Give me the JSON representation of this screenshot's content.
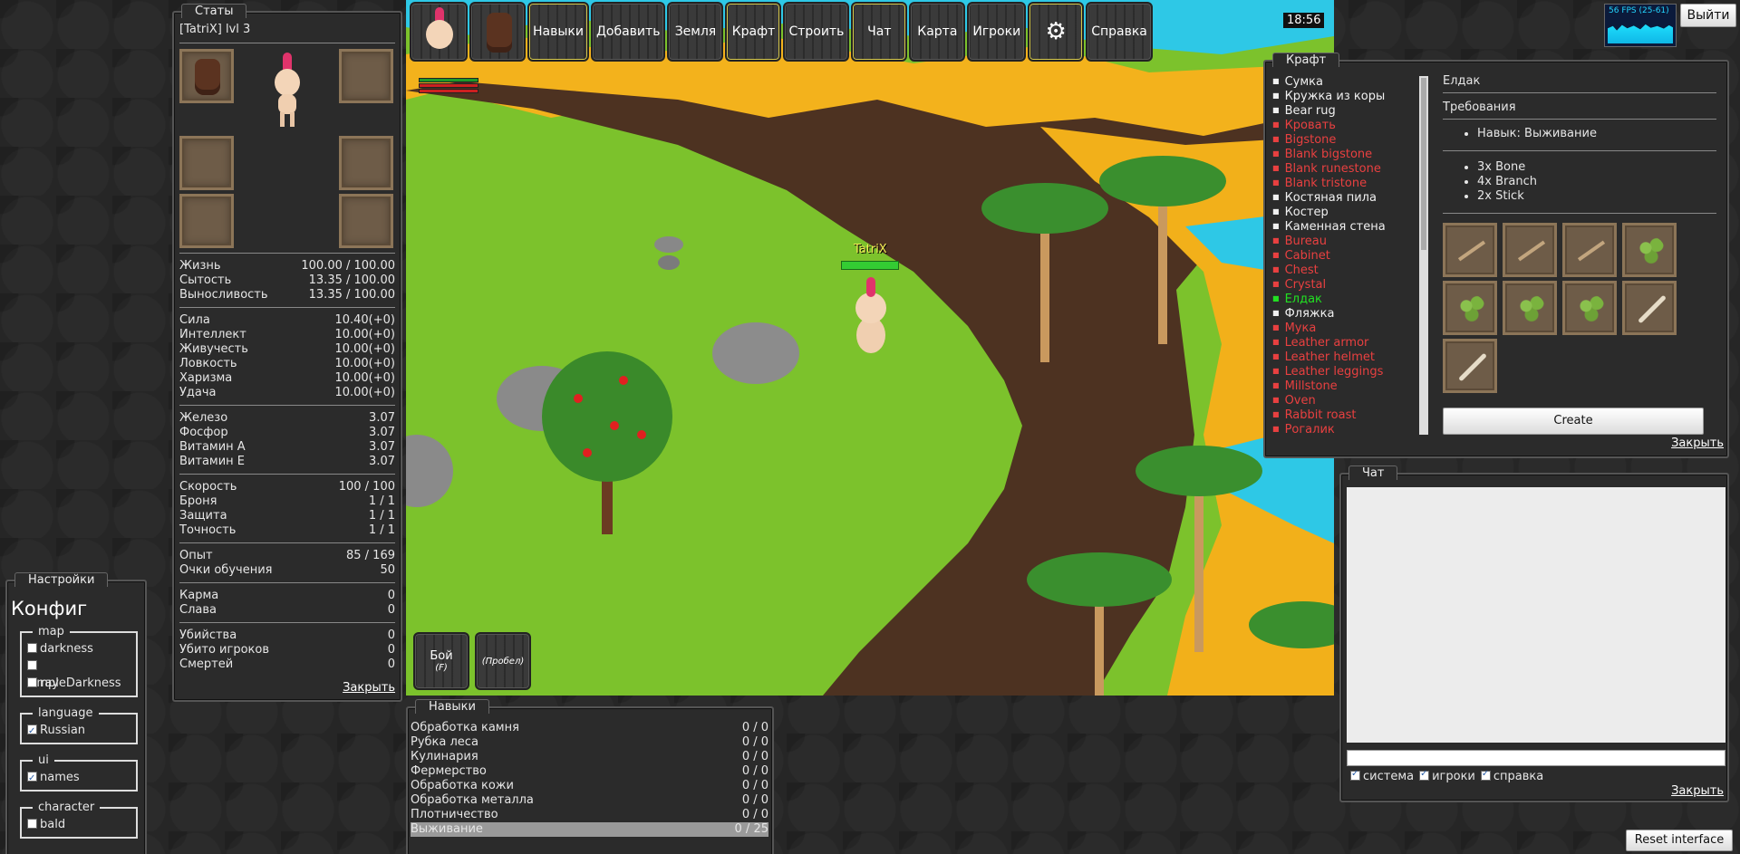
{
  "stats": {
    "tab": "Статы",
    "title": "[TatriX] lvl 3",
    "vitals": [
      {
        "label": "Жизнь",
        "value": "100.00 / 100.00"
      },
      {
        "label": "Сытость",
        "value": "13.35 / 100.00"
      },
      {
        "label": "Выносливость",
        "value": "13.35 / 100.00"
      }
    ],
    "attributes": [
      {
        "label": "Сила",
        "value": "10.40(+0)"
      },
      {
        "label": "Интеллект",
        "value": "10.00(+0)"
      },
      {
        "label": "Живучесть",
        "value": "10.00(+0)"
      },
      {
        "label": "Ловкость",
        "value": "10.00(+0)"
      },
      {
        "label": "Харизма",
        "value": "10.00(+0)"
      },
      {
        "label": "Удача",
        "value": "10.00(+0)"
      }
    ],
    "nutrients": [
      {
        "label": "Железо",
        "value": "3.07"
      },
      {
        "label": "Фосфор",
        "value": "3.07"
      },
      {
        "label": "Витамин A",
        "value": "3.07"
      },
      {
        "label": "Витамин E",
        "value": "3.07"
      }
    ],
    "combat": [
      {
        "label": "Скорость",
        "value": "100 / 100"
      },
      {
        "label": "Броня",
        "value": "1 / 1"
      },
      {
        "label": "Защита",
        "value": "1 / 1"
      },
      {
        "label": "Точность",
        "value": "1 / 1"
      }
    ],
    "progress": [
      {
        "label": "Опыт",
        "value": "85 / 169"
      },
      {
        "label": "Очки обучения",
        "value": "50"
      }
    ],
    "reputation": [
      {
        "label": "Карма",
        "value": "0"
      },
      {
        "label": "Слава",
        "value": "0"
      }
    ],
    "kills": [
      {
        "label": "Убийства",
        "value": "0"
      },
      {
        "label": "Убито игроков",
        "value": "0"
      },
      {
        "label": "Смертей",
        "value": "0"
      }
    ],
    "close": "Закрыть"
  },
  "toolbar": {
    "buttons": [
      "Навыки",
      "Добавить",
      "Земля",
      "Крафт",
      "Строить",
      "Чат",
      "Карта",
      "Игроки"
    ],
    "settings_icon": "gear-icon",
    "help": "Справка"
  },
  "clock": "18:56",
  "player": {
    "name": "TatriX"
  },
  "actions": [
    {
      "label": "Бой",
      "hint": "(F)"
    },
    {
      "label": "",
      "hint": "(Пробел)"
    }
  ],
  "fps": {
    "label": "56 FPS (25-61)"
  },
  "exit": "Выйти",
  "reset": "Reset interface",
  "craft": {
    "tab": "Крафт",
    "recipes": [
      {
        "name": "Сумка",
        "state": "normal"
      },
      {
        "name": "Кружка из коры",
        "state": "normal"
      },
      {
        "name": "Bear rug",
        "state": "normal"
      },
      {
        "name": "Кровать",
        "state": "red"
      },
      {
        "name": "Bigstone",
        "state": "red"
      },
      {
        "name": "Blank bigstone",
        "state": "red"
      },
      {
        "name": "Blank runestone",
        "state": "red"
      },
      {
        "name": "Blank tristone",
        "state": "red"
      },
      {
        "name": "Костяная пила",
        "state": "normal"
      },
      {
        "name": "Костер",
        "state": "normal"
      },
      {
        "name": "Каменная стена",
        "state": "normal"
      },
      {
        "name": "Bureau",
        "state": "red"
      },
      {
        "name": "Cabinet",
        "state": "red"
      },
      {
        "name": "Chest",
        "state": "red"
      },
      {
        "name": "Crystal",
        "state": "red"
      },
      {
        "name": "Елдак",
        "state": "green"
      },
      {
        "name": "Фляжка",
        "state": "normal"
      },
      {
        "name": "Мука",
        "state": "red"
      },
      {
        "name": "Leather armor",
        "state": "red"
      },
      {
        "name": "Leather helmet",
        "state": "red"
      },
      {
        "name": "Leather leggings",
        "state": "red"
      },
      {
        "name": "Millstone",
        "state": "red"
      },
      {
        "name": "Oven",
        "state": "red"
      },
      {
        "name": "Rabbit roast",
        "state": "red"
      },
      {
        "name": "Рогалик",
        "state": "red"
      }
    ],
    "selected": "Елдак",
    "requirements_label": "Требования",
    "skill_req": "Навык: Выживание",
    "ingredients": [
      "3x Bone",
      "4x Branch",
      "2x Stick"
    ],
    "slots": [
      "stick",
      "stick",
      "stick",
      "branch",
      "branch",
      "branch",
      "branch",
      "bone",
      "bone"
    ],
    "create": "Create",
    "close": "Закрыть"
  },
  "chat": {
    "tab": "Чат",
    "filters": [
      {
        "label": "система",
        "checked": true
      },
      {
        "label": "игроки",
        "checked": true
      },
      {
        "label": "справка",
        "checked": true
      }
    ],
    "close": "Закрыть"
  },
  "skills": {
    "tab": "Навыки",
    "items": [
      {
        "label": "Обработка камня",
        "value": "0 / 0"
      },
      {
        "label": "Рубка леса",
        "value": "0 / 0"
      },
      {
        "label": "Кулинария",
        "value": "0 / 0"
      },
      {
        "label": "Фермерство",
        "value": "0 / 0"
      },
      {
        "label": "Обработка кожи",
        "value": "0 / 0"
      },
      {
        "label": "Обработка металла",
        "value": "0 / 0"
      },
      {
        "label": "Плотничество",
        "value": "0 / 0"
      },
      {
        "label": "Выживание",
        "value": "0 / 25"
      }
    ]
  },
  "settings": {
    "tab": "Настройки",
    "title": "Конфиг",
    "groups": [
      {
        "legend": "map",
        "options": [
          {
            "label": "darkness",
            "checked": false
          },
          {
            "label": "simpleDarkness",
            "checked": false
          },
          {
            "label": "ray",
            "checked": false
          }
        ]
      },
      {
        "legend": "language",
        "options": [
          {
            "label": "Russian",
            "checked": true
          }
        ]
      },
      {
        "legend": "ui",
        "options": [
          {
            "label": "names",
            "checked": true
          }
        ]
      },
      {
        "legend": "character",
        "options": [
          {
            "label": "bald",
            "checked": false
          }
        ]
      }
    ]
  }
}
